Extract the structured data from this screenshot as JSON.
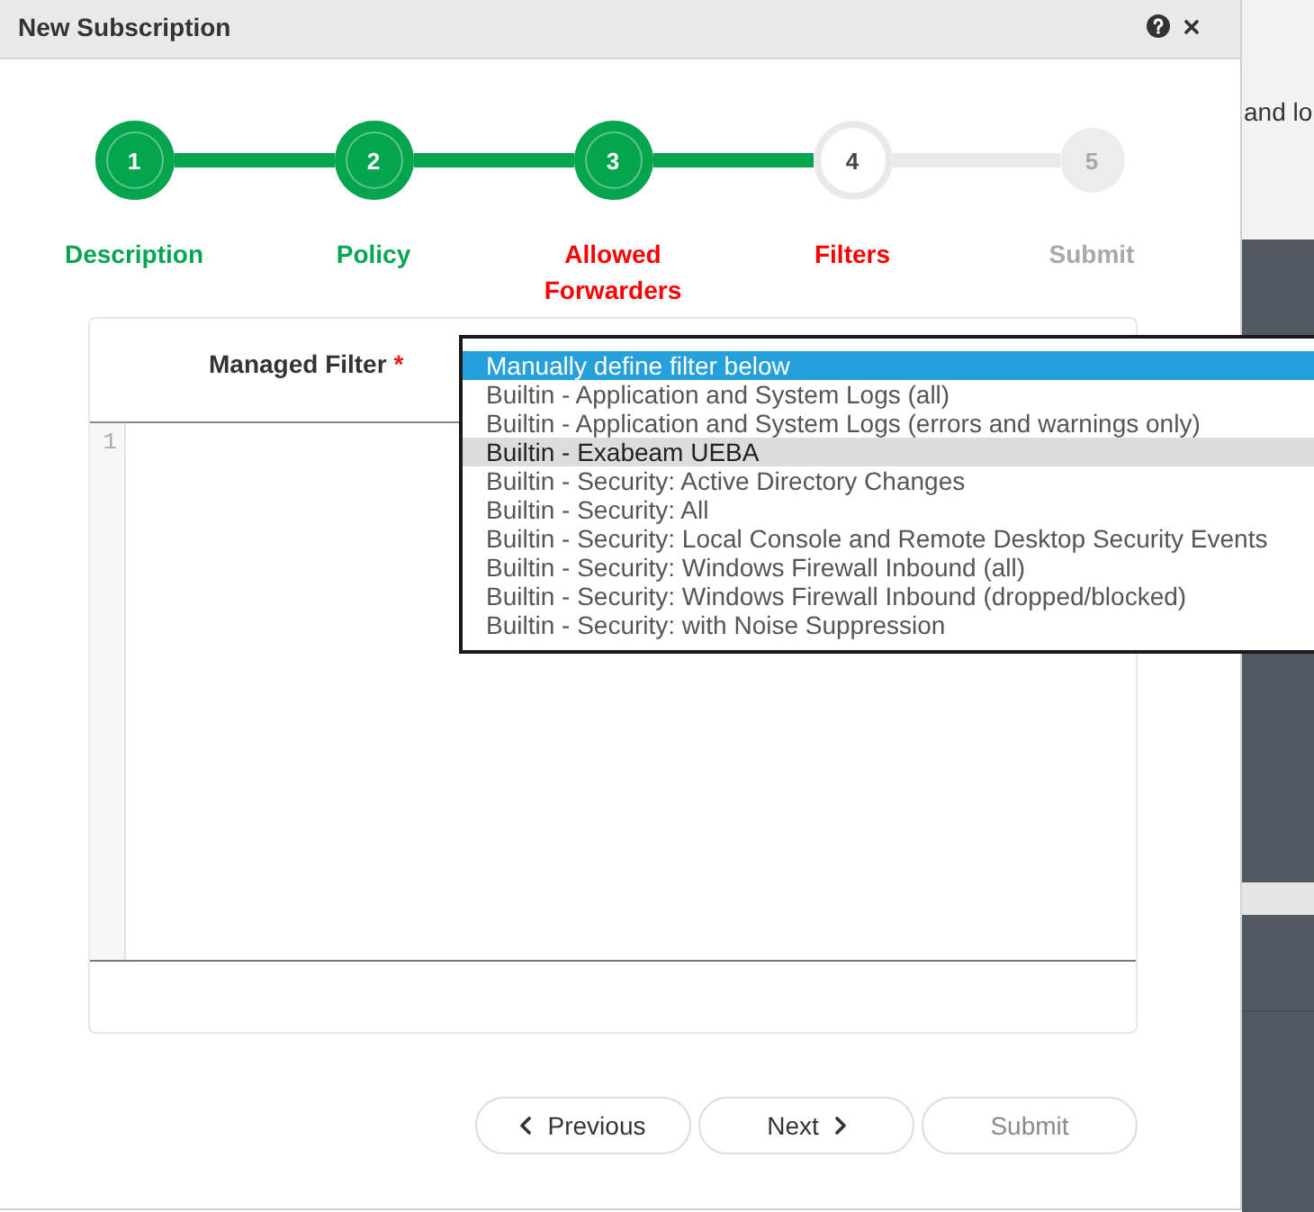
{
  "dialog": {
    "title": "New Subscription"
  },
  "steps": [
    {
      "number": "1",
      "label": "Description",
      "completed": true,
      "current": false,
      "error": false
    },
    {
      "number": "2",
      "label": "Policy",
      "completed": true,
      "current": false,
      "error": false
    },
    {
      "number": "3",
      "label": "Allowed Forwarders",
      "completed": true,
      "current": false,
      "error": true
    },
    {
      "number": "4",
      "label": "Filters",
      "completed": false,
      "current": true,
      "error": true
    },
    {
      "number": "5",
      "label": "Submit",
      "completed": false,
      "current": false,
      "error": false
    }
  ],
  "filter_panel": {
    "label": "Managed Filter",
    "required_mark": "*",
    "options": [
      {
        "label": "Manually define filter below",
        "selected": true,
        "hovered": false
      },
      {
        "label": "Builtin - Application and System Logs (all)",
        "selected": false,
        "hovered": false
      },
      {
        "label": "Builtin - Application and System Logs (errors and warnings only)",
        "selected": false,
        "hovered": false
      },
      {
        "label": "Builtin - Exabeam UEBA",
        "selected": false,
        "hovered": true
      },
      {
        "label": "Builtin - Security: Active Directory Changes",
        "selected": false,
        "hovered": false
      },
      {
        "label": "Builtin - Security: All",
        "selected": false,
        "hovered": false
      },
      {
        "label": "Builtin - Security: Local Console and Remote Desktop Security Events",
        "selected": false,
        "hovered": false
      },
      {
        "label": "Builtin - Security: Windows Firewall Inbound (all)",
        "selected": false,
        "hovered": false
      },
      {
        "label": "Builtin - Security: Windows Firewall Inbound (dropped/blocked)",
        "selected": false,
        "hovered": false
      },
      {
        "label": "Builtin - Security: with Noise Suppression",
        "selected": false,
        "hovered": false
      }
    ],
    "editor": {
      "line_numbers": [
        "1"
      ]
    }
  },
  "buttons": [
    {
      "label": "Previous",
      "kind": "previous",
      "disabled": false
    },
    {
      "label": "Next",
      "kind": "next",
      "disabled": false
    },
    {
      "label": "Submit",
      "kind": "submit",
      "disabled": true
    }
  ],
  "background_page": {
    "text": "and lo"
  }
}
